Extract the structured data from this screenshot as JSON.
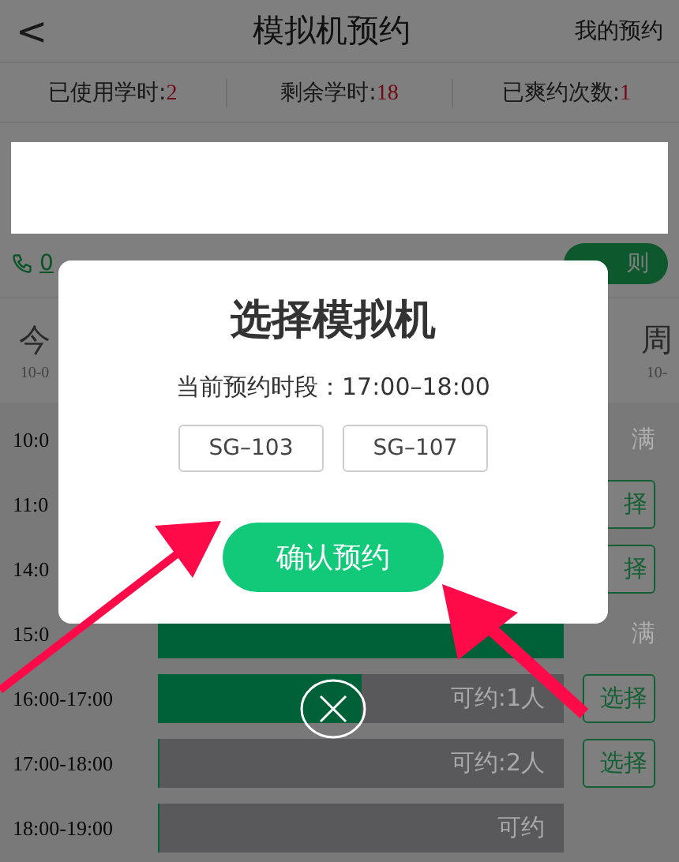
{
  "header": {
    "back": "<",
    "title": "模拟机预约",
    "action": "我的预约"
  },
  "stats": [
    {
      "label": "已使用学时:",
      "value": "2"
    },
    {
      "label": "剩余学时:",
      "value": "18"
    },
    {
      "label": "已爽约次数:",
      "value": "1"
    }
  ],
  "info": {
    "phone": "0",
    "rules_button": "则"
  },
  "dates": [
    {
      "day": "今",
      "date": "10-0"
    },
    {
      "day": "周",
      "date": "10-"
    }
  ],
  "slots": [
    {
      "time": "10:0",
      "kind": "full",
      "status": "满"
    },
    {
      "time": "11:0",
      "kind": "button",
      "status": "择"
    },
    {
      "time": "14:0",
      "kind": "button",
      "status": "择"
    },
    {
      "time": "15:0",
      "kind": "bar",
      "level": 1,
      "status": "满"
    },
    {
      "time": "16:00-17:00",
      "kind": "barbutton",
      "level": 0.5,
      "bar_text": "可约:1人",
      "status": "选择"
    },
    {
      "time": "17:00-18:00",
      "kind": "barbutton",
      "level": 0,
      "bar_text": "可约:2人",
      "status": "选择"
    },
    {
      "time": "18:00-19:00",
      "kind": "bar",
      "level": 0,
      "bar_text": "可约"
    }
  ],
  "dialog": {
    "title": "选择模拟机",
    "period": "当前预约时段：17:00–18:00",
    "options": [
      {
        "label": "SG–103",
        "selected": false
      },
      {
        "label": "SG–107",
        "selected": false
      }
    ],
    "confirm": "确认预约"
  }
}
